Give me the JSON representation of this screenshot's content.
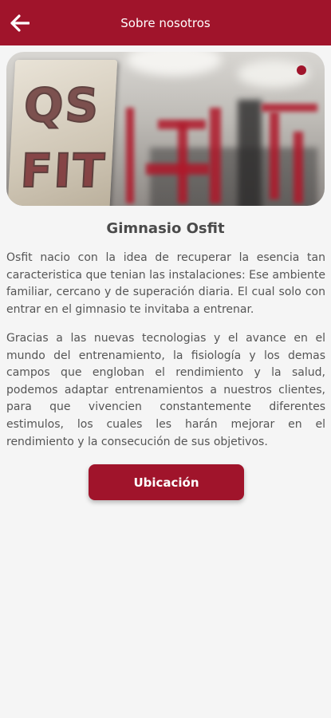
{
  "app_bar": {
    "title": "Sobre nosotros",
    "back_icon": "arrow-left-icon",
    "color": "#a0142b"
  },
  "hero": {
    "sign_text_top": "QS",
    "sign_text_bottom": "FIT",
    "carousel_active_index": 1,
    "carousel_total": 1
  },
  "content": {
    "title": "Gimnasio Osfit",
    "paragraph_1": "Osfit nacio con la idea de recuperar la esencia tan caracteristica que tenian las instalaciones: Ese ambiente familiar, cercano y de superación diaria. El cual solo con entrar en el gimnasio te invitaba a entrenar.",
    "paragraph_2": "Gracias a las nuevas tecnologias y el avance en el mundo del entrenamiento, la fisiología y los demas campos que engloban el rendimiento y la salud, podemos adaptar entrenamientos a nuestros clientes, para que vivencien constantemente diferentes estimulos, los cuales les harán mejorar en el rendimiento y la consecución de sus objetivos."
  },
  "actions": {
    "location_label": "Ubicación"
  }
}
